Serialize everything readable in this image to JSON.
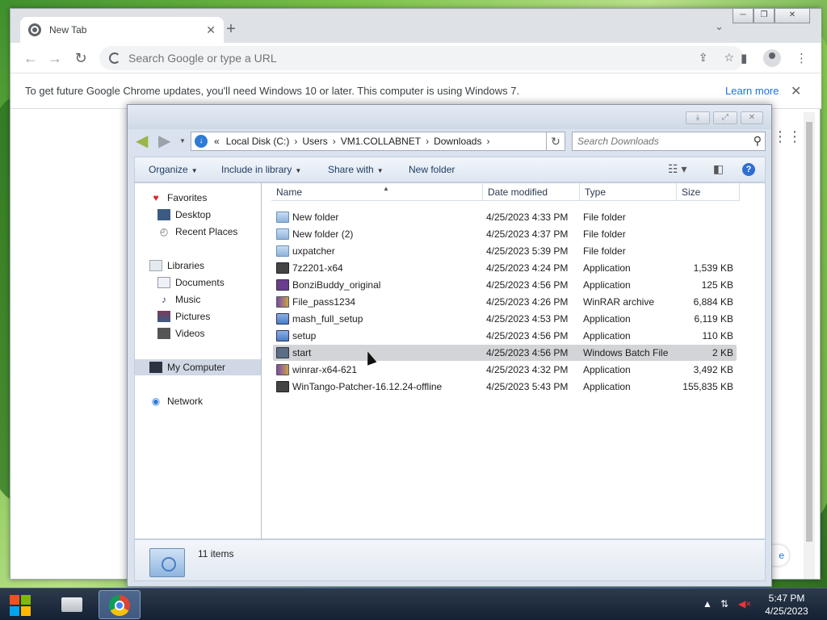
{
  "chrome": {
    "tab_title": "New Tab",
    "omnibox_placeholder": "Search Google or type a URL",
    "infobar_text": "To get future Google Chrome updates, you'll need Windows 10 or later. This computer is using Windows 7.",
    "infobar_link": "Learn more",
    "tiny_btn_text": "e"
  },
  "explorer": {
    "address": {
      "prefix": "«",
      "segments": [
        "Local Disk (C:)",
        "Users",
        "VM1.COLLABNET",
        "Downloads"
      ]
    },
    "search_placeholder": "Search Downloads",
    "commands": {
      "organize": "Organize",
      "include": "Include in library",
      "share": "Share with",
      "new_folder": "New folder"
    },
    "nav": {
      "favorites": "Favorites",
      "desktop": "Desktop",
      "recent": "Recent Places",
      "libraries": "Libraries",
      "documents": "Documents",
      "music": "Music",
      "pictures": "Pictures",
      "videos": "Videos",
      "computer": "My Computer",
      "network": "Network"
    },
    "columns": {
      "name": "Name",
      "date": "Date modified",
      "type": "Type",
      "size": "Size"
    },
    "files": [
      {
        "name": "New folder",
        "date": "4/25/2023 4:33 PM",
        "type": "File folder",
        "size": "",
        "icon": "folder-icon"
      },
      {
        "name": "New folder (2)",
        "date": "4/25/2023 4:37 PM",
        "type": "File folder",
        "size": "",
        "icon": "folder-icon"
      },
      {
        "name": "uxpatcher",
        "date": "4/25/2023 5:39 PM",
        "type": "File folder",
        "size": "",
        "icon": "folder-icon"
      },
      {
        "name": "7z2201-x64",
        "date": "4/25/2023 4:24 PM",
        "type": "Application",
        "size": "1,539 KB",
        "icon": "7zip-icon"
      },
      {
        "name": "BonziBuddy_original",
        "date": "4/25/2023 4:56 PM",
        "type": "Application",
        "size": "125 KB",
        "icon": "bonzi-icon"
      },
      {
        "name": "File_pass1234",
        "date": "4/25/2023 4:26 PM",
        "type": "WinRAR archive",
        "size": "6,884 KB",
        "icon": "rar-archive-icon"
      },
      {
        "name": "mash_full_setup",
        "date": "4/25/2023 4:53 PM",
        "type": "Application",
        "size": "6,119 KB",
        "icon": "installer-icon"
      },
      {
        "name": "setup",
        "date": "4/25/2023 4:56 PM",
        "type": "Application",
        "size": "110 KB",
        "icon": "setup-icon"
      },
      {
        "name": "start",
        "date": "4/25/2023 4:56 PM",
        "type": "Windows Batch File",
        "size": "2 KB",
        "icon": "batch-file-icon"
      },
      {
        "name": "winrar-x64-621",
        "date": "4/25/2023 4:32 PM",
        "type": "Application",
        "size": "3,492 KB",
        "icon": "winrar-icon"
      },
      {
        "name": "WinTango-Patcher-16.12.24-offline",
        "date": "4/25/2023 5:43 PM",
        "type": "Application",
        "size": "155,835 KB",
        "icon": "app-icon"
      }
    ],
    "hovered_file": "start",
    "item_count": "11 items"
  },
  "taskbar": {
    "time": "5:47 PM",
    "date": "4/25/2023"
  }
}
